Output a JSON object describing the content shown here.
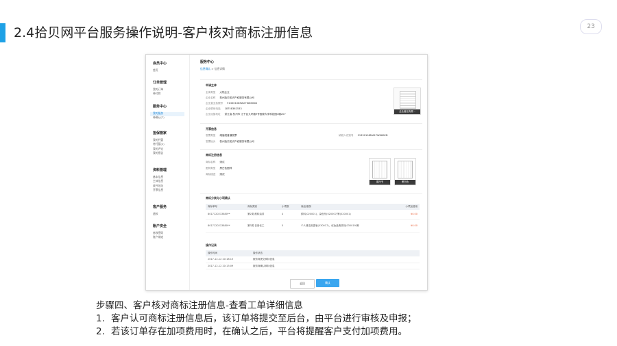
{
  "slide": {
    "title": "2.4拾贝网平台服务操作说明-客户核对商标注册信息",
    "page_number": "23"
  },
  "sidebar": {
    "groups": [
      {
        "head": "会员中心",
        "items": [
          "首页"
        ]
      },
      {
        "head": "订单管理",
        "items": [
          "我的订单",
          "待付款"
        ]
      },
      {
        "head": "服务中心",
        "items": [
          "我的服务",
          "待确认(7)"
        ]
      },
      {
        "head": "担保管家",
        "items": [
          "我的托管",
          "待托管(2)",
          "我的评论",
          "我的报告"
        ]
      },
      {
        "head": "资料管理",
        "items": [
          "基本信息",
          "主体信息",
          "收件地址",
          "开票信息"
        ]
      },
      {
        "head": "客户服务",
        "items": [
          "退款"
        ]
      },
      {
        "head": "账户安全",
        "items": [
          "修改密码",
          "账户绑定"
        ]
      }
    ]
  },
  "main": {
    "heading": "服务中心",
    "breadcrumb": {
      "link": "信息确认",
      "sep": " > ",
      "current": "信息详情"
    },
    "applicant": {
      "title": "申请主体",
      "rows": [
        {
          "label": "主体类型",
          "value": "大陆企业"
        },
        {
          "label": "企业名称",
          "value": "杭州拾贝知识产权服务有限公司"
        },
        {
          "label": "企业营业执照号",
          "value": "91330108MA27W660KD"
        },
        {
          "label": "企业联系电话",
          "value": "18758362533"
        },
        {
          "label": "企业经营地址",
          "value": "浙江省 杭州市 江干区九环路9号国家大学科技园4幢207"
        }
      ],
      "license_caption": "企业营业执照..."
    },
    "invoice": {
      "title": "开票信息",
      "type_label": "发票类型",
      "type_value": "增值税普通发票",
      "head_label": "发票抬头",
      "head_value": "杭州拾贝知识产权服务有限公司",
      "tax_label": "纳税人识别号",
      "tax_value": "91330108MA27W660KD"
    },
    "trademark": {
      "title": "商标注册信息",
      "rows": [
        {
          "label": "商标名称",
          "value": "测试"
        },
        {
          "label": "图样类型",
          "value": "黑白色图样"
        },
        {
          "label": "商标描述",
          "value": "测试"
        }
      ],
      "cards": [
        "委托书",
        "黑白色"
      ]
    },
    "classes": {
      "title": "商标分类与小项确认",
      "headers": [
        "商标单号",
        "商标类别",
        "小项数",
        "商品/服务",
        "小项加费用"
      ],
      "rows": [
        {
          "order": "8017120213880**",
          "cls": "第2类:颜料油漆",
          "count": "4",
          "items": "颜料(020001)、染色剂(020007)等(020001)",
          "fee": "¥0.00"
        },
        {
          "order": "8017120213880**",
          "cls": "第3类:日用化工",
          "count": "5",
          "items": "个人清洁用香皂(030017)、化妆品清洗剂(030019)等",
          "fee": "¥0.00"
        }
      ]
    },
    "log": {
      "title": "操作记录",
      "headers": [
        "操作时间",
        "操作状态"
      ],
      "rows": [
        {
          "time": "2017-12-12 20:18:13",
          "status": "服务商提交商标信息"
        },
        {
          "time": "2017-12-12 20:13:09",
          "status": "服务商确认商标信息"
        }
      ]
    },
    "buttons": {
      "return": "返回",
      "confirm": "确认"
    }
  },
  "caption": {
    "step": "步骤四、客户核对商标注册信息-查看工单详细信息",
    "items": [
      {
        "num": "1.",
        "text": "客户认可商标注册信息后，该订单将提交至后台，由平台进行审核及申报；"
      },
      {
        "num": "2.",
        "text": "若该订单存在加项费用时，在确认之后，平台将提醒客户支付加项费用。"
      }
    ]
  }
}
